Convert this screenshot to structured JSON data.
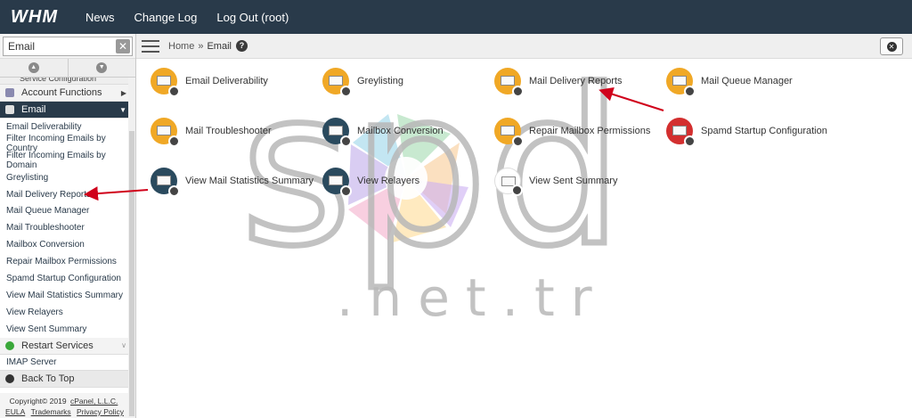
{
  "topbar": {
    "logo": "WHM",
    "nav": [
      "News",
      "Change Log",
      "Log Out (root)"
    ]
  },
  "search": {
    "value": "Email",
    "clear_icon": "close-icon"
  },
  "sidebar": {
    "cut_label": "Service Configuration",
    "categories": [
      {
        "label": "Account Functions",
        "icon": "user-icon"
      },
      {
        "label": "Email",
        "icon": "envelope-icon"
      }
    ],
    "email_items": [
      "Email Deliverability",
      "Filter Incoming Emails by Country",
      "Filter Incoming Emails by Domain",
      "Greylisting",
      "Mail Delivery Reports",
      "Mail Queue Manager",
      "Mail Troubleshooter",
      "Mailbox Conversion",
      "Repair Mailbox Permissions",
      "Spamd Startup Configuration",
      "View Mail Statistics Summary",
      "View Relayers",
      "View Sent Summary"
    ],
    "restart_label": "Restart Services",
    "restart_items": [
      "IMAP Server"
    ],
    "back_to_top": "Back To Top",
    "footer": {
      "copyright": "Copyright© 2019",
      "company": "cPanel, L.L.C.",
      "links": [
        "EULA",
        "Trademarks",
        "Privacy Policy"
      ]
    }
  },
  "breadcrumb": {
    "home": "Home",
    "sep": "»",
    "current": "Email"
  },
  "tiles": [
    {
      "label": "Email Deliverability",
      "color": "#f0a826"
    },
    {
      "label": "Greylisting",
      "color": "#f0a826"
    },
    {
      "label": "Mail Delivery Reports",
      "color": "#f0a826"
    },
    {
      "label": "Mail Queue Manager",
      "color": "#f0a826"
    },
    {
      "label": "Mail Troubleshooter",
      "color": "#f0a826"
    },
    {
      "label": "Mailbox Conversion",
      "color": "#2a4a5e"
    },
    {
      "label": "Repair Mailbox Permissions",
      "color": "#f0a826"
    },
    {
      "label": "Spamd Startup Configuration",
      "color": "#d32f2f"
    },
    {
      "label": "View Mail Statistics Summary",
      "color": "#2a4a5e"
    },
    {
      "label": "View Relayers",
      "color": "#2a4a5e"
    },
    {
      "label": "View Sent Summary",
      "color": "#ffffff"
    }
  ],
  "watermark": {
    "top": "spd",
    "bottom": ".net.tr"
  },
  "colors": {
    "topbar": "#293a4a",
    "accent": "#f0a826",
    "arrow": "#d0021b"
  }
}
